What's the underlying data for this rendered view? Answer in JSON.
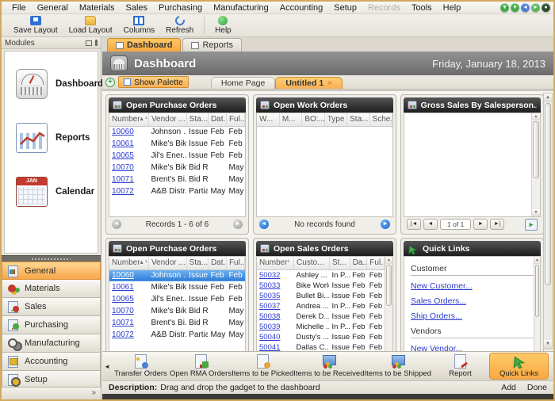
{
  "menu": {
    "items": [
      {
        "label": "File"
      },
      {
        "label": "General"
      },
      {
        "label": "Materials"
      },
      {
        "label": "Sales"
      },
      {
        "label": "Purchasing"
      },
      {
        "label": "Manufacturing"
      },
      {
        "label": "Accounting"
      },
      {
        "label": "Setup"
      },
      {
        "label": "Records",
        "disabled": true
      },
      {
        "label": "Tools"
      },
      {
        "label": "Help"
      }
    ]
  },
  "window_controls": [
    {
      "name": "nav-down-icon",
      "glyph": "▼",
      "color": "#3fae49"
    },
    {
      "name": "nav-down2-icon",
      "glyph": "▼",
      "color": "#3fae49"
    },
    {
      "name": "undo-icon",
      "glyph": "◄",
      "color": "#4a7fd4"
    },
    {
      "name": "pointer-icon",
      "glyph": "►",
      "color": "#58b85c"
    },
    {
      "name": "power-icon",
      "glyph": "●",
      "color": "#2e4d2e"
    }
  ],
  "toolbar": {
    "buttons": [
      {
        "label": "Save Layout",
        "icon": "save-icon"
      },
      {
        "label": "Load Layout",
        "icon": "folder-icon"
      },
      {
        "label": "Columns",
        "icon": "columns-icon"
      },
      {
        "label": "Refresh",
        "icon": "refresh-icon"
      }
    ],
    "help": {
      "label": "Help",
      "icon": "help-icon"
    }
  },
  "modules_panel": {
    "title": "Modules",
    "items": [
      {
        "label": "Dashboard",
        "icon": "gauge-icon"
      },
      {
        "label": "Reports",
        "icon": "chart-icon"
      },
      {
        "label": "Calendar",
        "icon": "calendar-icon"
      }
    ]
  },
  "accordion": {
    "items": [
      {
        "label": "General",
        "icon": "ico-general",
        "selected": true
      },
      {
        "label": "Materials",
        "icon": "ico-materials"
      },
      {
        "label": "Sales",
        "icon": "ico-sales"
      },
      {
        "label": "Purchasing",
        "icon": "ico-purchasing"
      },
      {
        "label": "Manufacturing",
        "icon": "ico-manufacturing"
      },
      {
        "label": "Accounting",
        "icon": "ico-accounting"
      },
      {
        "label": "Setup",
        "icon": "ico-setup"
      }
    ],
    "footer_glyph": "»"
  },
  "module_tabs": [
    {
      "label": "Dashboard",
      "active": true
    },
    {
      "label": "Reports",
      "active": false
    }
  ],
  "header": {
    "title": "Dashboard",
    "date": "Friday, January 18, 2013"
  },
  "pagebar": {
    "add_glyph": "+",
    "show_palette": "Show Palette",
    "tabs": [
      {
        "label": "Home Page",
        "active": false
      },
      {
        "label": "Untitled 1",
        "active": true,
        "close_glyph": "×"
      }
    ]
  },
  "gadgets": {
    "po_top": {
      "title": "Open Purchase Orders",
      "sort_marker": "▴ ¹",
      "columns": [
        "Number",
        "Vendor ...",
        "Sta...",
        "Dat...",
        "Ful..."
      ],
      "rows": [
        [
          "10060",
          "Johnson ...",
          "Issued",
          "Feb ...",
          "Feb ..."
        ],
        [
          "10061",
          "Mike's Bikes",
          "Issued",
          "Feb ...",
          "Feb ..."
        ],
        [
          "10065",
          "Jil's Ener...",
          "Issued",
          "Feb ...",
          "Feb ..."
        ],
        [
          "10070",
          "Mike's Bikes",
          "Bid R...",
          "",
          "May ..."
        ],
        [
          "10071",
          "Brent's Bi...",
          "Bid R...",
          "",
          "May ..."
        ],
        [
          "10072",
          "A&B Distr...",
          "Partial",
          "May ...",
          "May ..."
        ]
      ],
      "footer": "Records 1 - 6 of 6"
    },
    "wo": {
      "title": "Open Work Orders",
      "columns": [
        "W...",
        "M...",
        "BO:...",
        "Type",
        "Sta...",
        "Sche..."
      ],
      "rows": [],
      "footer": "No records found"
    },
    "gross_sales": {
      "title": "Gross Sales By Salesperson...",
      "pager": "1 of 1"
    },
    "po_bottom": {
      "title": "Open Purchase Orders",
      "sort_marker": "▴ ¹",
      "selected_row": 0,
      "columns": [
        "Number",
        "Vendor ...",
        "Sta...",
        "Dat...",
        "Ful..."
      ],
      "rows": [
        [
          "10060",
          "Johnson ...",
          "Issued",
          "Feb ...",
          "Feb ..."
        ],
        [
          "10061",
          "Mike's Bikes",
          "Issued",
          "Feb ...",
          "Feb ..."
        ],
        [
          "10065",
          "Jil's Ener...",
          "Issued",
          "Feb ...",
          "Feb ..."
        ],
        [
          "10070",
          "Mike's Bikes",
          "Bid R...",
          "",
          "May ..."
        ],
        [
          "10071",
          "Brent's Bi...",
          "Bid R...",
          "",
          "May ..."
        ],
        [
          "10072",
          "A&B Distr...",
          "Partial",
          "May ...",
          "May ..."
        ]
      ]
    },
    "so": {
      "title": "Open Sales Orders",
      "sort_marker": "¹",
      "columns": [
        "Number",
        "Custo...",
        "St...",
        "Da...",
        "Ful..."
      ],
      "rows": [
        [
          "50032",
          "Ashley ...",
          "In P...",
          "Feb ...",
          "Feb ..."
        ],
        [
          "50033",
          "Bike World",
          "Issued",
          "Feb ...",
          "Feb ..."
        ],
        [
          "50035",
          "Bullet Bi...",
          "Issued",
          "Feb ...",
          "Feb ..."
        ],
        [
          "50037",
          "Andrea ...",
          "In P...",
          "Feb ...",
          "Feb ..."
        ],
        [
          "50038",
          "Derek D...",
          "Issued",
          "Feb ...",
          "Feb ..."
        ],
        [
          "50039",
          "Michelle ...",
          "In P...",
          "Feb ...",
          "Feb ..."
        ],
        [
          "50040",
          "Dusty's ...",
          "Issued",
          "Feb ...",
          "Feb ..."
        ],
        [
          "50041",
          "Dallas C...",
          "Issued",
          "Feb ...",
          "Feb ..."
        ]
      ]
    },
    "quick_links": {
      "title": "Quick Links",
      "sections": [
        {
          "header": "Customer",
          "links": [
            "New Customer...",
            "Sales Orders...",
            "Ship Orders..."
          ]
        },
        {
          "header": "Vendors",
          "links": [
            "New Vendor..."
          ]
        }
      ]
    }
  },
  "palette": {
    "scroll_left_glyph": "◄",
    "items": [
      {
        "label": "Transfer Orders",
        "icon": "pal-doc pal-transfer"
      },
      {
        "label": "Open RMA Orders",
        "icon": "pal-doc pal-rma"
      },
      {
        "label": "Items to be Picked",
        "icon": "pal-doc pal-picked"
      },
      {
        "label": "Items to be Received",
        "icon": "pal-box"
      },
      {
        "label": "Items to be Shipped",
        "icon": "pal-box"
      },
      {
        "label": "Report",
        "icon": "pal-doc pal-report"
      },
      {
        "label": "Quick Links",
        "icon": "cursor",
        "selected": true
      }
    ]
  },
  "description_bar": {
    "label": "Description:",
    "text": "Drag and drop the gadget to the dashboard",
    "actions": [
      "Add",
      "Done"
    ]
  },
  "colors": {
    "accent_orange": "#f6a540",
    "link_blue": "#2b3bcf",
    "selection_blue": "#2e7cd6",
    "frame_tan": "#d3a95f"
  }
}
